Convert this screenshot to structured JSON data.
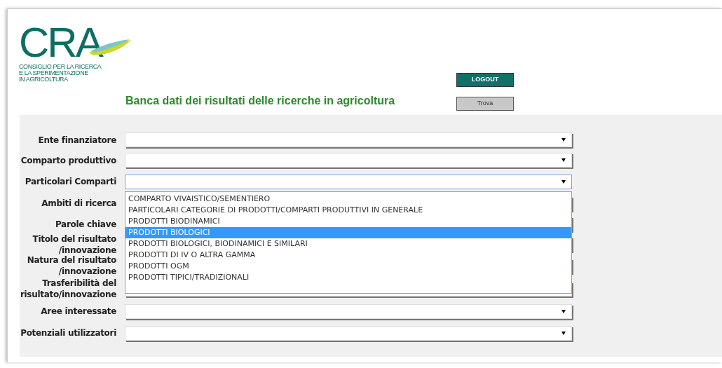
{
  "logo": {
    "text": "CRA",
    "subtitle": [
      "CONSIGLIO PER LA RICERCA",
      "E LA SPERIMENTAZIONE",
      "IN AGRICOLTURA"
    ]
  },
  "title": "Banca dati dei risultati delle ricerche in agricoltura",
  "buttons": [
    {
      "kind": "logout",
      "label": "LOGOUT"
    },
    {
      "kind": "search",
      "label": "Trova"
    }
  ],
  "fields": [
    {
      "label": "Ente finanziatore",
      "open": false
    },
    {
      "label": "Comparto produttivo",
      "open": false
    },
    {
      "label": "Particolari Comparti",
      "open": true,
      "options": [
        {
          "label": "COMPARTO VIVAISTICO/SEMENTIERO",
          "selected": false
        },
        {
          "label": "PARTICOLARI CATEGORIE DI PRODOTTI/COMPARTI PRODUTTIVI IN GENERALE",
          "selected": false
        },
        {
          "label": "PRODOTTI BIODINAMICI",
          "selected": false
        },
        {
          "label": "PRODOTTI BIOLOGICI",
          "selected": true
        },
        {
          "label": "PRODOTTI BIOLOGICI, BIODINAMICI E SIMILARI",
          "selected": false
        },
        {
          "label": "PRODOTTI DI IV O ALTRA GAMMA",
          "selected": false
        },
        {
          "label": "PRODOTTI OGM",
          "selected": false
        },
        {
          "label": "PRODOTTI TIPICI/TRADIZIONALI",
          "selected": false
        }
      ]
    },
    {
      "label": "Ambiti di ricerca",
      "open": false
    },
    {
      "label": "Parole chiave",
      "open": false
    },
    {
      "label": "Titolo del risultato /innovazione",
      "open": false
    },
    {
      "label": "Natura del risultato /innovazione",
      "open": false
    },
    {
      "label": "Trasferibilità del risultato/innovazione",
      "open": false
    },
    {
      "label": "Aree interessate",
      "open": false
    },
    {
      "label": "Potenziali utilizzatori",
      "open": false
    }
  ]
}
